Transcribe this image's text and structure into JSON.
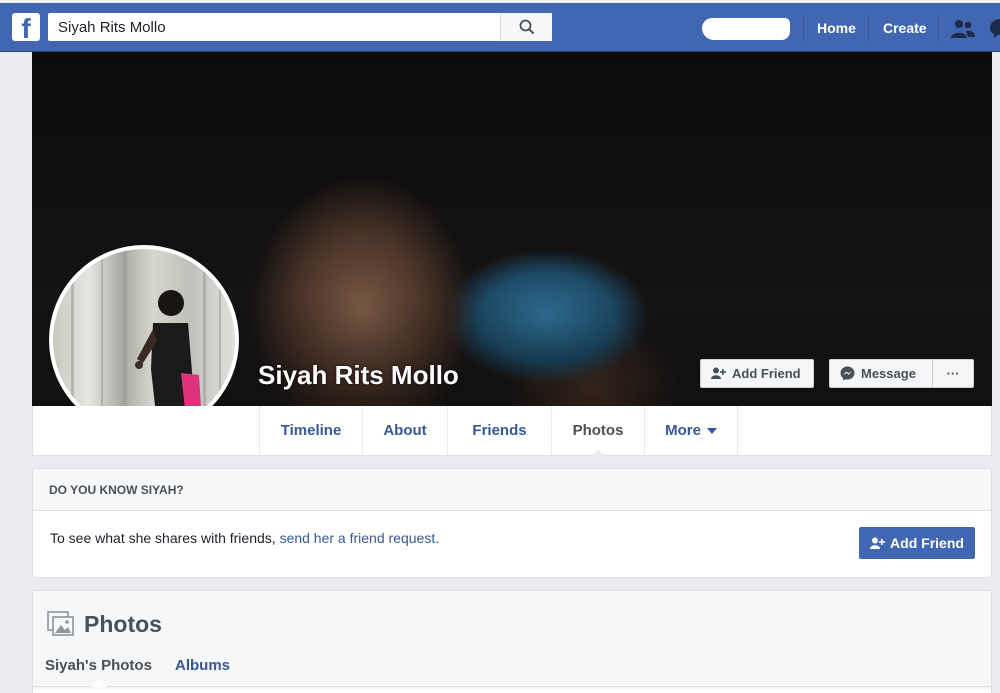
{
  "topbar": {
    "logo_letter": "f",
    "search_value": "Siyah Rits Mollo",
    "nav": {
      "home": "Home",
      "create": "Create"
    }
  },
  "profile": {
    "name": "Siyah Rits Mollo",
    "buttons": {
      "add_friend": "Add Friend",
      "message": "Message",
      "more": "···"
    }
  },
  "tabs": [
    "Timeline",
    "About",
    "Friends",
    "Photos",
    "More"
  ],
  "active_tab": "Photos",
  "know_box": {
    "heading": "DO YOU KNOW SIYAH?",
    "text": "To see what she shares with friends, ",
    "link": "send her a friend request.",
    "button": "Add Friend"
  },
  "photos": {
    "title": "Photos",
    "tabs": [
      "Siyah's Photos",
      "Albums"
    ]
  },
  "colors": {
    "brand": "#4267b2",
    "link": "#365899",
    "page_bg": "#e9ebee"
  }
}
